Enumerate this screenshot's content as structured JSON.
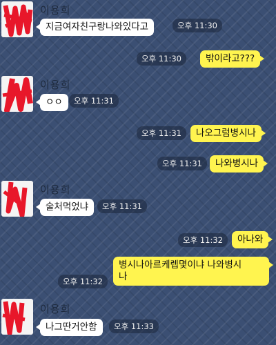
{
  "chat": {
    "sender_name": "이용희",
    "messages": [
      {
        "text": "지금여자친구랑나와있다고",
        "time": "오후 11:30"
      },
      {
        "text": "밖이라고???",
        "time": "오후 11:30"
      },
      {
        "text": "ㅇㅇ",
        "time": "오후 11:31"
      },
      {
        "text": "나오그럼병시나",
        "time": "오후 11:31"
      },
      {
        "text": "나와병시나",
        "time": "오후 11:31"
      },
      {
        "text": "술처먹었냐",
        "time": "오후 11:31"
      },
      {
        "text": "아나와",
        "time": "오후 11:32"
      },
      {
        "text": "병시나아르케렙몇이냐 나와병시나",
        "line1": "병시나아르케렙몇이냐 나와병시",
        "line2": "나",
        "time": "오후 11:32"
      },
      {
        "text": "나그딴거안함",
        "time": "오후 11:33"
      }
    ]
  },
  "colors": {
    "background": "#3b4f73",
    "incoming_bubble": "#ffffff",
    "outgoing_bubble": "#fff44f",
    "avatar_scribble": "#e8172a"
  }
}
